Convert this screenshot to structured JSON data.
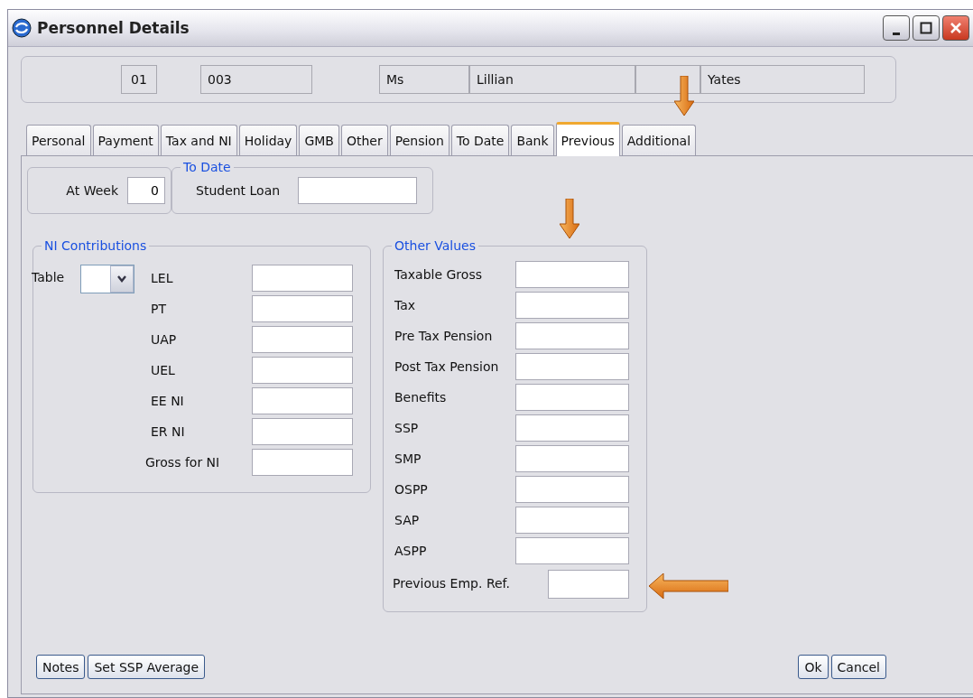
{
  "window": {
    "title": "Personnel Details"
  },
  "header_fields": [
    {
      "kind": "text",
      "value": "01"
    },
    {
      "kind": "text",
      "value": "003"
    },
    {
      "kind": "text",
      "value": "Ms"
    },
    {
      "kind": "text",
      "value": "Lillian"
    },
    {
      "kind": "blank"
    },
    {
      "kind": "text",
      "value": "Yates"
    }
  ],
  "tabs": [
    {
      "label": "Personal",
      "selected": false
    },
    {
      "label": "Payment",
      "selected": false
    },
    {
      "label": "Tax and NI",
      "selected": false
    },
    {
      "label": "Holiday",
      "selected": false
    },
    {
      "label": "GMB",
      "selected": false
    },
    {
      "label": "Other",
      "selected": false
    },
    {
      "label": "Pension",
      "selected": false
    },
    {
      "label": "To Date",
      "selected": false
    },
    {
      "label": "Bank",
      "selected": false
    },
    {
      "label": "Previous",
      "selected": true
    },
    {
      "label": "Additional",
      "selected": false
    }
  ],
  "at_week": {
    "label": "At Week",
    "value": "0"
  },
  "to_date": {
    "title": "To Date",
    "label": "Student Loan"
  },
  "ni_contributions": {
    "title": "NI Contributions",
    "table_label": "Table",
    "fields": [
      {
        "label": "LEL"
      },
      {
        "label": "PT"
      },
      {
        "label": "UAP"
      },
      {
        "label": "UEL"
      },
      {
        "label": "EE NI"
      },
      {
        "label": "ER NI"
      },
      {
        "label": "Gross for NI"
      }
    ]
  },
  "other_values": {
    "title": "Other Values",
    "fields": [
      {
        "label": "Taxable Gross"
      },
      {
        "label": "Tax"
      },
      {
        "label": "Pre Tax Pension"
      },
      {
        "label": "Post Tax Pension"
      },
      {
        "label": "Benefits"
      },
      {
        "label": "SSP"
      },
      {
        "label": "SMP"
      },
      {
        "label": "OSPP"
      },
      {
        "label": "SAP"
      },
      {
        "label": "ASPP"
      },
      {
        "label": "Previous Emp. Ref.",
        "kind": "short"
      }
    ]
  },
  "left_buttons": [
    "Notes",
    "Set SSP Average"
  ],
  "right_buttons": [
    "Ok",
    "Cancel"
  ]
}
